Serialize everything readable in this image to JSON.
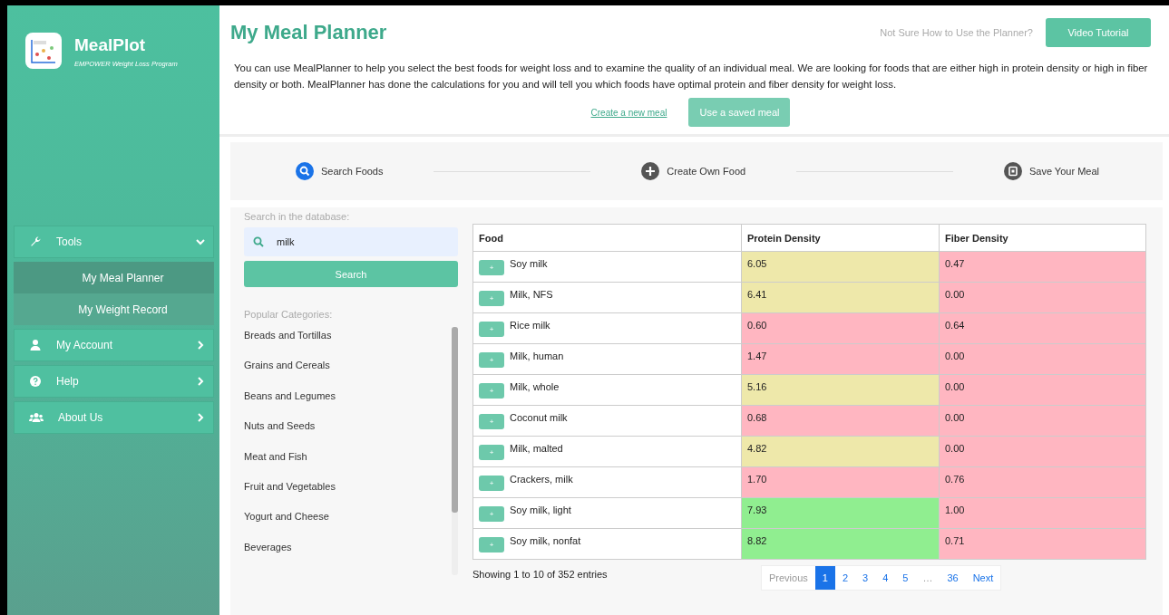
{
  "sidebar": {
    "brand": {
      "name": "MealPlot",
      "tagline": "EMPOWER Weight Loss Program"
    },
    "menu": [
      {
        "label": "Tools",
        "expanded": true,
        "children": [
          {
            "label": "My Meal Planner",
            "selected": true
          },
          {
            "label": "My Weight Record",
            "selected": false
          }
        ]
      },
      {
        "label": "My Account",
        "expanded": false
      },
      {
        "label": "Help",
        "expanded": false
      },
      {
        "label": "About Us",
        "expanded": false
      }
    ]
  },
  "header": {
    "title": "My Meal Planner",
    "hint": "Not Sure How to Use the Planner?",
    "video_button": "Video Tutorial",
    "description": "You can use MealPlanner to help you select the best foods for weight loss and to examine the quality of an individual meal. We are looking for foods that are either high in protein density or high in fiber density or both. MealPlanner has done the calculations for you and will tell you which foods have optimal protein and fiber density for weight loss.",
    "create_link": "Create a new meal",
    "saved_button": "Use a saved meal"
  },
  "steps": [
    {
      "label": "Search Foods",
      "selected": true
    },
    {
      "label": "Create Own Food",
      "selected": false
    },
    {
      "label": "Save Your Meal",
      "selected": false
    }
  ],
  "search": {
    "label": "Search in the database:",
    "query": "milk",
    "button": "Search",
    "categories_title": "Popular Categories:",
    "categories": [
      "Breads and Tortillas",
      "Grains and Cereals",
      "Beans and Legumes",
      "Nuts and Seeds",
      "Meat and Fish",
      "Fruit and Vegetables",
      "Yogurt and Cheese",
      "Beverages"
    ]
  },
  "table": {
    "columns": [
      "Food",
      "Protein Density",
      "Fiber Density"
    ],
    "rows": [
      {
        "add": "+",
        "food": "Soy milk",
        "protein": {
          "value": "6.05",
          "color": "#eee8aa"
        },
        "fiber": {
          "value": "0.47",
          "color": "#ffb6c1"
        }
      },
      {
        "add": "+",
        "food": "Milk, NFS",
        "protein": {
          "value": "6.41",
          "color": "#eee8aa"
        },
        "fiber": {
          "value": "0.00",
          "color": "#ffb6c1"
        }
      },
      {
        "add": "+",
        "food": "Rice milk",
        "protein": {
          "value": "0.60",
          "color": "#ffb6c1"
        },
        "fiber": {
          "value": "0.64",
          "color": "#ffb6c1"
        }
      },
      {
        "add": "+",
        "food": "Milk, human",
        "protein": {
          "value": "1.47",
          "color": "#ffb6c1"
        },
        "fiber": {
          "value": "0.00",
          "color": "#ffb6c1"
        }
      },
      {
        "add": "+",
        "food": "Milk, whole",
        "protein": {
          "value": "5.16",
          "color": "#eee8aa"
        },
        "fiber": {
          "value": "0.00",
          "color": "#ffb6c1"
        }
      },
      {
        "add": "+",
        "food": "Coconut milk",
        "protein": {
          "value": "0.68",
          "color": "#ffb6c1"
        },
        "fiber": {
          "value": "0.00",
          "color": "#ffb6c1"
        }
      },
      {
        "add": "+",
        "food": "Milk, malted",
        "protein": {
          "value": "4.82",
          "color": "#eee8aa"
        },
        "fiber": {
          "value": "0.00",
          "color": "#ffb6c1"
        }
      },
      {
        "add": "+",
        "food": "Crackers, milk",
        "protein": {
          "value": "1.70",
          "color": "#ffb6c1"
        },
        "fiber": {
          "value": "0.76",
          "color": "#ffb6c1"
        }
      },
      {
        "add": "+",
        "food": "Soy milk, light",
        "protein": {
          "value": "7.93",
          "color": "#90ee90"
        },
        "fiber": {
          "value": "1.00",
          "color": "#ffb6c1"
        }
      },
      {
        "add": "+",
        "food": "Soy milk, nonfat",
        "protein": {
          "value": "8.82",
          "color": "#90ee90"
        },
        "fiber": {
          "value": "0.71",
          "color": "#ffb6c1"
        }
      }
    ],
    "info": "Showing 1 to 10 of 352 entries",
    "pagination": [
      {
        "label": "Previous",
        "selected": false,
        "disabled": true
      },
      {
        "label": "1",
        "selected": true,
        "disabled": false
      },
      {
        "label": "2",
        "selected": false,
        "disabled": false
      },
      {
        "label": "3",
        "selected": false,
        "disabled": false
      },
      {
        "label": "4",
        "selected": false,
        "disabled": false
      },
      {
        "label": "5",
        "selected": false,
        "disabled": false
      },
      {
        "label": "…",
        "selected": false,
        "disabled": true
      },
      {
        "label": "36",
        "selected": false,
        "disabled": false
      },
      {
        "label": "Next",
        "selected": false,
        "disabled": false
      }
    ]
  }
}
